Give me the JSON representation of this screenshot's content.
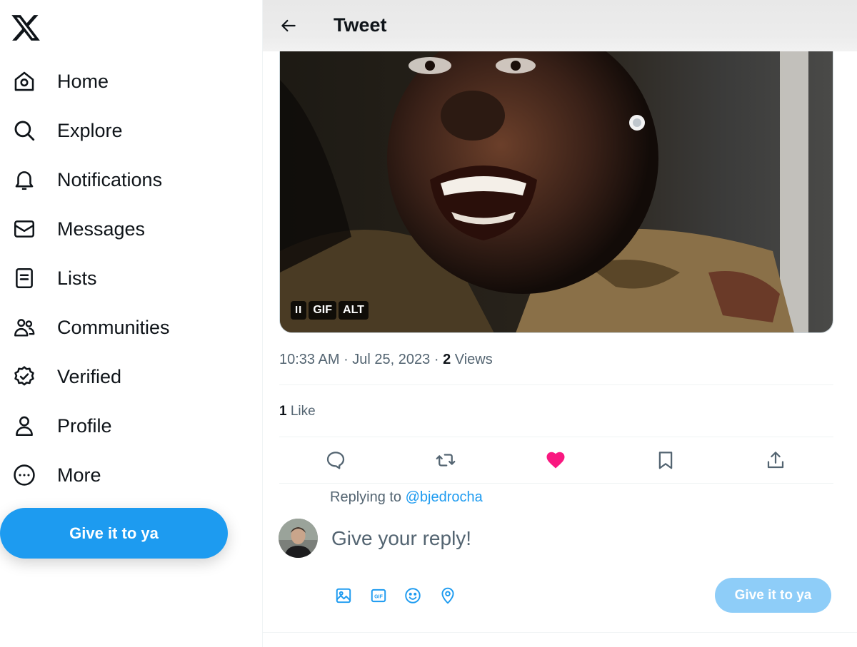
{
  "nav": {
    "logo": "x-logo-icon",
    "items": [
      {
        "label": "Home",
        "icon": "home-icon"
      },
      {
        "label": "Explore",
        "icon": "search-icon"
      },
      {
        "label": "Notifications",
        "icon": "bell-icon"
      },
      {
        "label": "Messages",
        "icon": "envelope-icon"
      },
      {
        "label": "Lists",
        "icon": "list-icon"
      },
      {
        "label": "Communities",
        "icon": "communities-icon"
      },
      {
        "label": "Verified",
        "icon": "verified-icon"
      },
      {
        "label": "Profile",
        "icon": "person-icon"
      },
      {
        "label": "More",
        "icon": "more-circle-icon"
      }
    ],
    "cta_label": "Give it to ya"
  },
  "header": {
    "title": "Tweet",
    "back_icon": "arrow-left-icon"
  },
  "tweet": {
    "media_badges": {
      "pause": "II",
      "gif": "GIF",
      "alt": "ALT"
    },
    "time": "10:33 AM",
    "separator": " · ",
    "date": "Jul 25, 2023",
    "views_count": "2",
    "views_label": " Views",
    "likes_count": "1",
    "likes_label": " Like",
    "liked": true
  },
  "reply": {
    "replying_prefix": "Replying to ",
    "replying_handle": "@bjedrocha",
    "placeholder": "Give your reply!",
    "button_label": "Give it to ya"
  },
  "colors": {
    "accent": "#1d9bf0",
    "accent_disabled": "#8ecdf8",
    "like": "#f91880",
    "text_primary": "#0f1419",
    "text_secondary": "#536471"
  }
}
